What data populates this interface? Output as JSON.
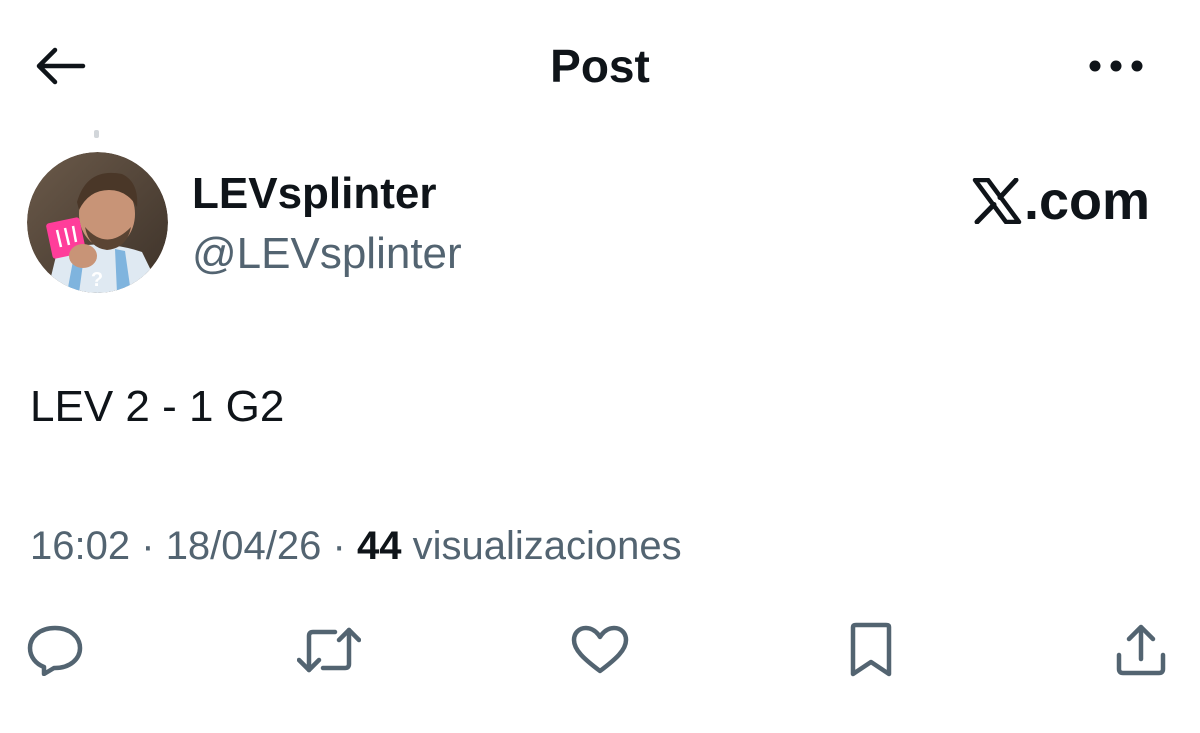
{
  "header": {
    "title": "Post",
    "back_icon": "arrow-left-icon",
    "more_icon": "more-horizontal-icon"
  },
  "author": {
    "name": "LEVsplinter",
    "handle": "@LEVsplinter",
    "avatar_icon": "avatar-photo"
  },
  "brand": {
    "text": ".com",
    "logo_icon": "x-logo-icon"
  },
  "post": {
    "text": "LEV 2 - 1 G2",
    "time": "16:02",
    "date": "18/04/26",
    "separator": "·",
    "views_count": "44",
    "views_label": "visualizaciones"
  },
  "actions": {
    "reply_icon": "reply-icon",
    "repost_icon": "repost-icon",
    "like_icon": "heart-icon",
    "bookmark_icon": "bookmark-icon",
    "share_icon": "share-icon"
  },
  "colors": {
    "text_primary": "#0f1419",
    "text_secondary": "#536471",
    "icon": "#536471",
    "background": "#ffffff"
  }
}
